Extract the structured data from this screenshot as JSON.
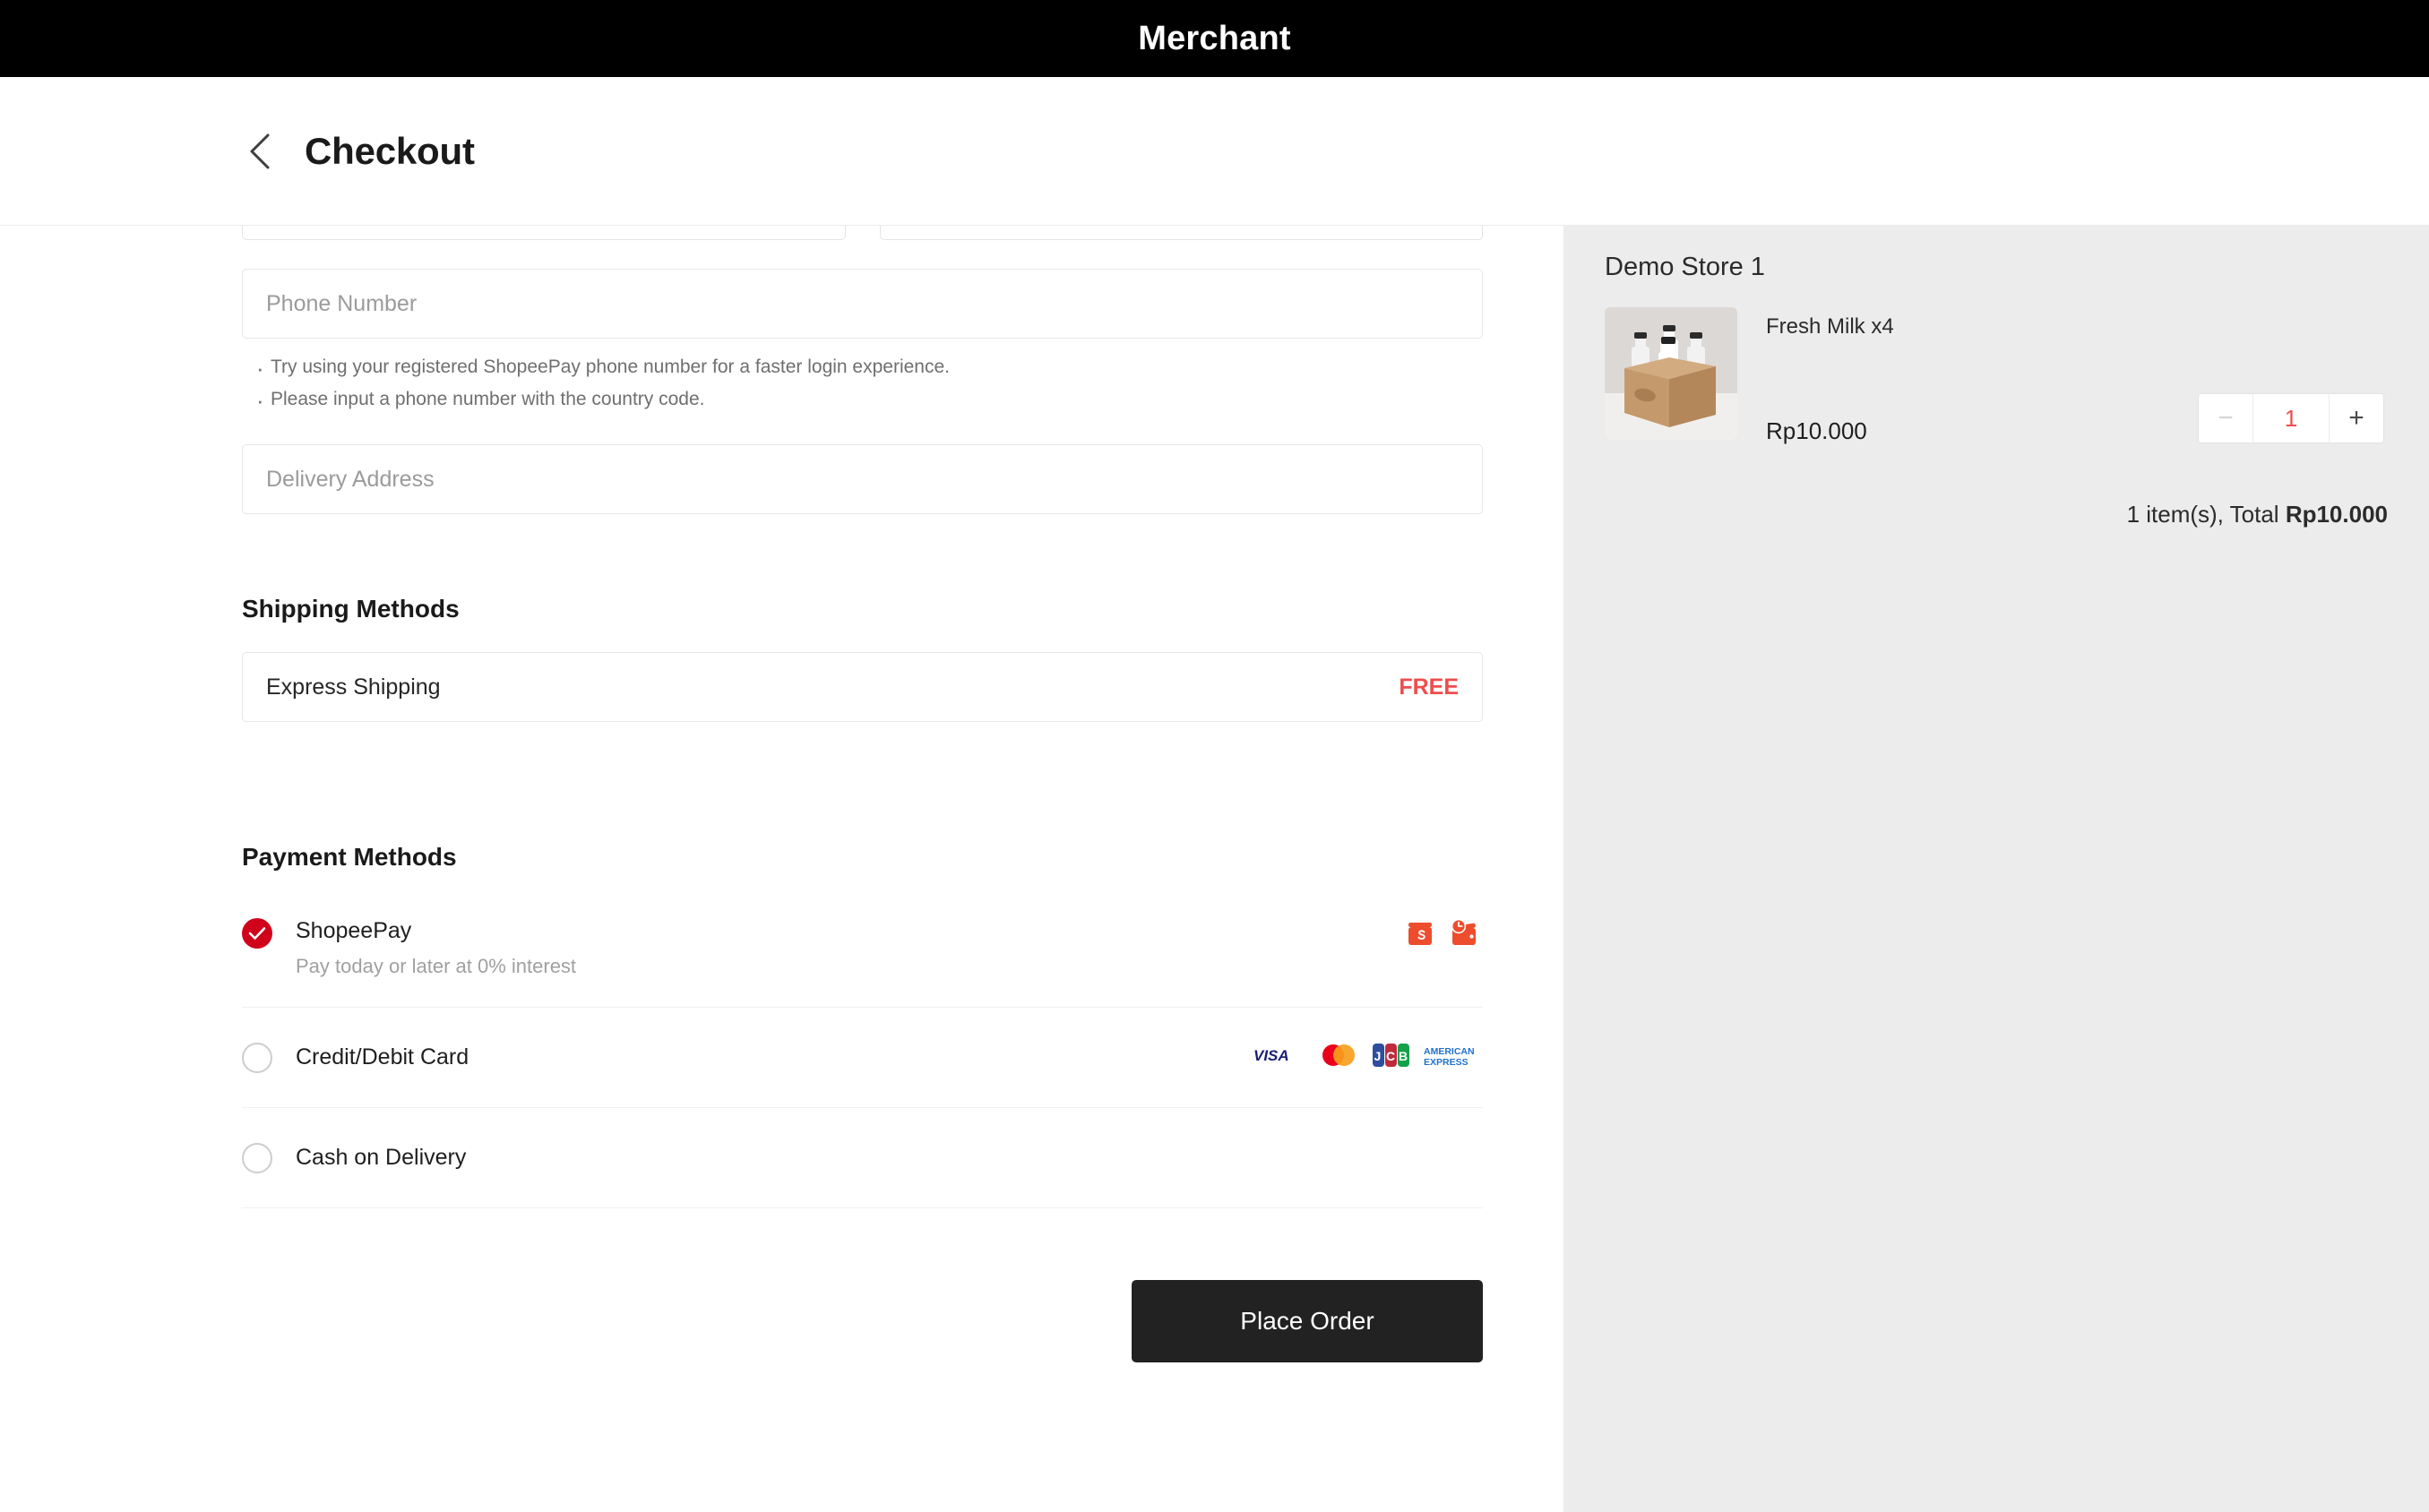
{
  "topbar": {
    "merchant_title": "Merchant"
  },
  "header": {
    "back_icon": "chevron-left-icon",
    "page_title": "Checkout"
  },
  "form": {
    "phone": {
      "placeholder": "Phone Number",
      "value": "",
      "notes": [
        "Try using your registered ShopeePay phone number for a faster login experience.",
        "Please input a phone number with the country code."
      ]
    },
    "address": {
      "placeholder": "Delivery Address",
      "value": ""
    }
  },
  "shipping": {
    "section_title": "Shipping Methods",
    "options": [
      {
        "name": "Express Shipping",
        "price": "FREE",
        "price_color": "#ee4d4d"
      }
    ]
  },
  "payment": {
    "section_title": "Payment Methods",
    "selected_color": "#d0021b",
    "options": [
      {
        "label": "ShopeePay",
        "sublabel": "Pay today or later at 0% interest",
        "selected": true,
        "icons": [
          "shopeepay-wallet-icon",
          "shopee-paylater-icon"
        ]
      },
      {
        "label": "Credit/Debit Card",
        "sublabel": "",
        "selected": false,
        "icons": [
          "visa-icon",
          "mastercard-icon",
          "jcb-icon",
          "amex-icon"
        ]
      },
      {
        "label": "Cash on Delivery",
        "sublabel": "",
        "selected": false,
        "icons": []
      }
    ]
  },
  "actions": {
    "place_order_label": "Place Order"
  },
  "summary": {
    "store_name": "Demo Store 1",
    "item": {
      "name": "Fresh Milk x4",
      "price": "Rp10.000",
      "quantity": "1",
      "thumbnail": "milk-bottles-carrier-image",
      "minus_label": "−",
      "plus_label": "+"
    },
    "totals_prefix": "1 item(s), Total ",
    "totals_amount": "Rp10.000"
  }
}
